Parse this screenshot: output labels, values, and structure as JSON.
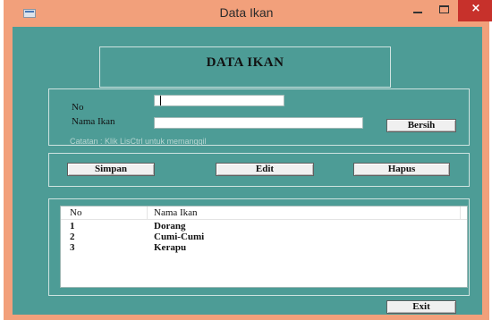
{
  "window": {
    "title": "Data Ikan",
    "close_glyph": "×"
  },
  "heading": "DATA IKAN",
  "form": {
    "no_label": "No",
    "nama_label": "Nama Ikan",
    "no_value": "",
    "nama_value": "",
    "note": "Catatan : Klik LisCtrl untuk memanggil"
  },
  "buttons": {
    "bersih": "Bersih",
    "simpan": "Simpan",
    "edit": "Edit",
    "hapus": "Hapus",
    "exit": "Exit"
  },
  "list": {
    "columns": [
      "No",
      "Nama Ikan"
    ],
    "rows": [
      {
        "no": "1",
        "nama": "Dorang"
      },
      {
        "no": "2",
        "nama": "Cumi-Cumi"
      },
      {
        "no": "3",
        "nama": "Kerapu"
      }
    ]
  },
  "colors": {
    "titlebar": "#f2a07b",
    "client": "#4d9c96",
    "close_button": "#c7312b"
  },
  "icons": [
    "app-icon",
    "minimize-icon",
    "maximize-icon",
    "close-icon"
  ]
}
